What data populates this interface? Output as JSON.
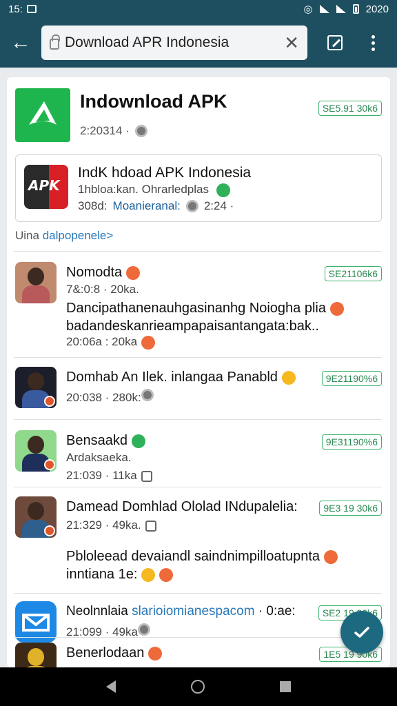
{
  "status": {
    "time": "15:",
    "right": "2020"
  },
  "toolbar": {
    "url": "Download APR Indonesia"
  },
  "hero": {
    "title": "Indownload APK",
    "meta": "2:20314 ·",
    "badge": "SE5.91 30k6"
  },
  "featured": {
    "title": "IndK hdoad APK Indonesia",
    "subtitle": "1hbloa:kan. Ohrarledplas",
    "meta_left": "308d:",
    "meta_link": "Moanieranal:",
    "meta_right": "2:24 ·",
    "icon_label": "APK"
  },
  "more": {
    "prefix": "Uina",
    "link": "dalpopenele>"
  },
  "posts": [
    {
      "name": "Nomodta",
      "sub": "7&:0:8 · 20ka.",
      "body1": "Dancipathanenauhgasinanhg Noiogha plia",
      "body2": "badandeskanrieampapaisantangata:bak..",
      "meta": "20:06a : 20ka",
      "badge": "SE21106k6"
    },
    {
      "name": "Domhab An Ilek. inlangaa Panabld",
      "meta": "20:038 · 280k:",
      "badge": "9E21190%6"
    },
    {
      "name": "Bensaakd",
      "sub": "Ardaksaeka.",
      "meta": "21:039 · 11ka",
      "badge": "9E31190%6"
    },
    {
      "name": "Damead Domhlad Ololad INdupalelia:",
      "meta": "21:329 · 49ka.",
      "body1": "Pbloleead devaiandl saindnimpilloatupnta",
      "body2": "inntiana 1e:",
      "badge": "9E3 19 30k6"
    },
    {
      "name": "Neolnnlaia",
      "link": "slarioiomianespacom",
      "extra": "· 0:ae:",
      "meta": "21:099 · 49ka",
      "badge": "SE2 19 90k6"
    },
    {
      "name": "Benerlodaan",
      "badge": "1E5 19 90k6"
    }
  ]
}
